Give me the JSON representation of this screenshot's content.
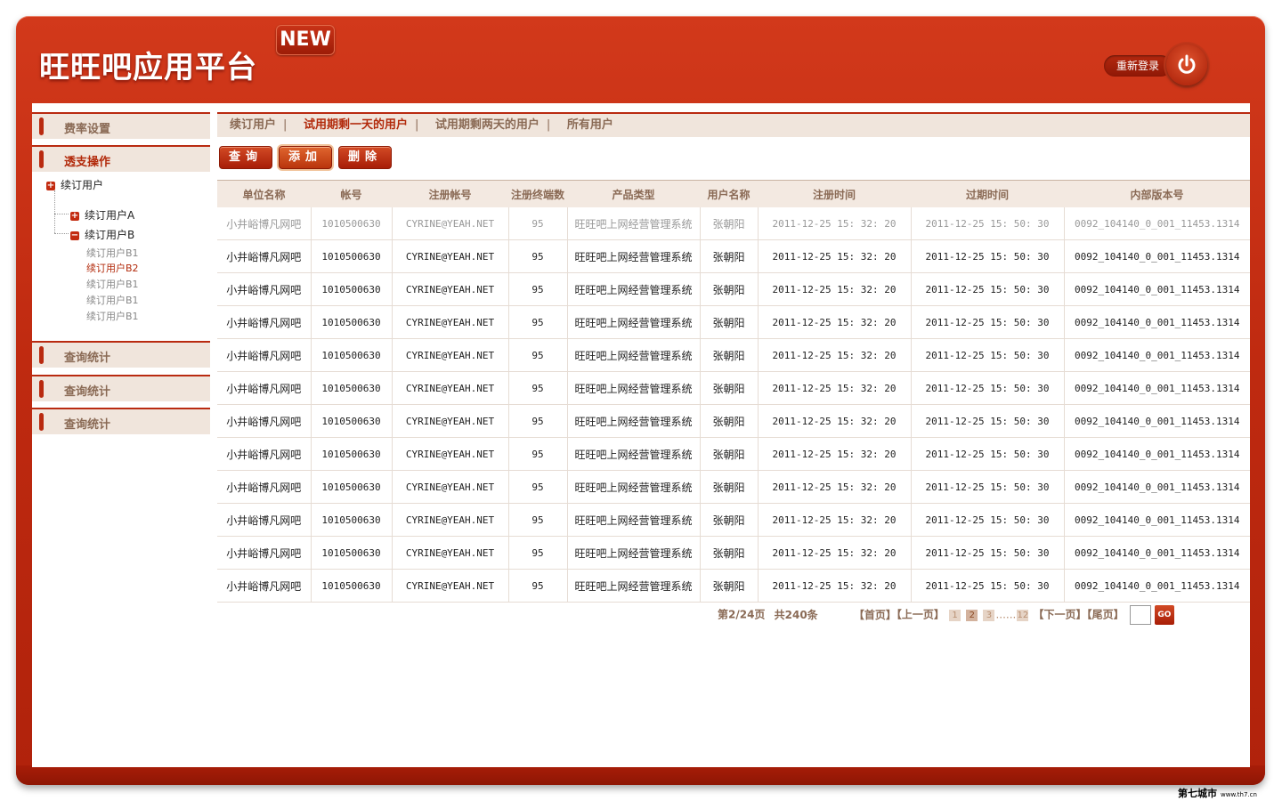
{
  "header": {
    "logo_text": "旺旺吧应用平台",
    "badge": "NEW",
    "relogin_label": "重新登录"
  },
  "sidebar": {
    "sections": [
      "费率设置",
      "透支操作",
      "查询统计",
      "查询统计",
      "查询统计"
    ],
    "tree": {
      "root": "续订用户",
      "a": "续订用户A",
      "b": "续订用户B",
      "leaves": [
        "续订用户B1",
        "续订用户B2",
        "续订用户B1",
        "续订用户B1",
        "续订用户B1"
      ]
    }
  },
  "tabs": [
    "续订用户",
    "试用期剩一天的用户",
    "试用期剩两天的用户",
    "所有用户"
  ],
  "toolbar": {
    "query": "查询",
    "add": "添加",
    "delete": "删除"
  },
  "table": {
    "columns": [
      "单位名称",
      "帐号",
      "注册帐号",
      "注册终端数",
      "产品类型",
      "用户名称",
      "注册时间",
      "过期时间",
      "内部版本号"
    ],
    "rows": [
      [
        "小井峪博凡网吧",
        "1010500630",
        "CYRINE@YEAH.NET",
        "95",
        "旺旺吧上网经营管理系统",
        "张朝阳",
        "2011-12-25 15: 32: 20",
        "2011-12-25 15: 50: 30",
        "0092_104140_0_001_11453.1314"
      ],
      [
        "小井峪博凡网吧",
        "1010500630",
        "CYRINE@YEAH.NET",
        "95",
        "旺旺吧上网经营管理系统",
        "张朝阳",
        "2011-12-25 15: 32: 20",
        "2011-12-25 15: 50: 30",
        "0092_104140_0_001_11453.1314"
      ],
      [
        "小井峪博凡网吧",
        "1010500630",
        "CYRINE@YEAH.NET",
        "95",
        "旺旺吧上网经营管理系统",
        "张朝阳",
        "2011-12-25 15: 32: 20",
        "2011-12-25 15: 50: 30",
        "0092_104140_0_001_11453.1314"
      ],
      [
        "小井峪博凡网吧",
        "1010500630",
        "CYRINE@YEAH.NET",
        "95",
        "旺旺吧上网经营管理系统",
        "张朝阳",
        "2011-12-25 15: 32: 20",
        "2011-12-25 15: 50: 30",
        "0092_104140_0_001_11453.1314"
      ],
      [
        "小井峪博凡网吧",
        "1010500630",
        "CYRINE@YEAH.NET",
        "95",
        "旺旺吧上网经营管理系统",
        "张朝阳",
        "2011-12-25 15: 32: 20",
        "2011-12-25 15: 50: 30",
        "0092_104140_0_001_11453.1314"
      ],
      [
        "小井峪博凡网吧",
        "1010500630",
        "CYRINE@YEAH.NET",
        "95",
        "旺旺吧上网经营管理系统",
        "张朝阳",
        "2011-12-25 15: 32: 20",
        "2011-12-25 15: 50: 30",
        "0092_104140_0_001_11453.1314"
      ],
      [
        "小井峪博凡网吧",
        "1010500630",
        "CYRINE@YEAH.NET",
        "95",
        "旺旺吧上网经营管理系统",
        "张朝阳",
        "2011-12-25 15: 32: 20",
        "2011-12-25 15: 50: 30",
        "0092_104140_0_001_11453.1314"
      ],
      [
        "小井峪博凡网吧",
        "1010500630",
        "CYRINE@YEAH.NET",
        "95",
        "旺旺吧上网经营管理系统",
        "张朝阳",
        "2011-12-25 15: 32: 20",
        "2011-12-25 15: 50: 30",
        "0092_104140_0_001_11453.1314"
      ],
      [
        "小井峪博凡网吧",
        "1010500630",
        "CYRINE@YEAH.NET",
        "95",
        "旺旺吧上网经营管理系统",
        "张朝阳",
        "2011-12-25 15: 32: 20",
        "2011-12-25 15: 50: 30",
        "0092_104140_0_001_11453.1314"
      ],
      [
        "小井峪博凡网吧",
        "1010500630",
        "CYRINE@YEAH.NET",
        "95",
        "旺旺吧上网经营管理系统",
        "张朝阳",
        "2011-12-25 15: 32: 20",
        "2011-12-25 15: 50: 30",
        "0092_104140_0_001_11453.1314"
      ],
      [
        "小井峪博凡网吧",
        "1010500630",
        "CYRINE@YEAH.NET",
        "95",
        "旺旺吧上网经营管理系统",
        "张朝阳",
        "2011-12-25 15: 32: 20",
        "2011-12-25 15: 50: 30",
        "0092_104140_0_001_11453.1314"
      ],
      [
        "小井峪博凡网吧",
        "1010500630",
        "CYRINE@YEAH.NET",
        "95",
        "旺旺吧上网经营管理系统",
        "张朝阳",
        "2011-12-25 15: 32: 20",
        "2011-12-25 15: 50: 30",
        "0092_104140_0_001_11453.1314"
      ]
    ]
  },
  "pager": {
    "summary_page": "第2/24页",
    "summary_total": "共240条",
    "first": "【首页】",
    "prev": "【上一页】",
    "pages": [
      "1",
      "2",
      "3"
    ],
    "ellipsis": "......",
    "last_page": "12",
    "next": "【下一页】",
    "last": "【尾页】",
    "go": "GO"
  },
  "watermark": {
    "brand": "第七城市",
    "url": "www.th7.cn"
  },
  "colors": {
    "primary": "#b92a10",
    "header_bg": "#f0e5dc",
    "label": "#8a6a55",
    "accent_text": "#b22a0b"
  }
}
